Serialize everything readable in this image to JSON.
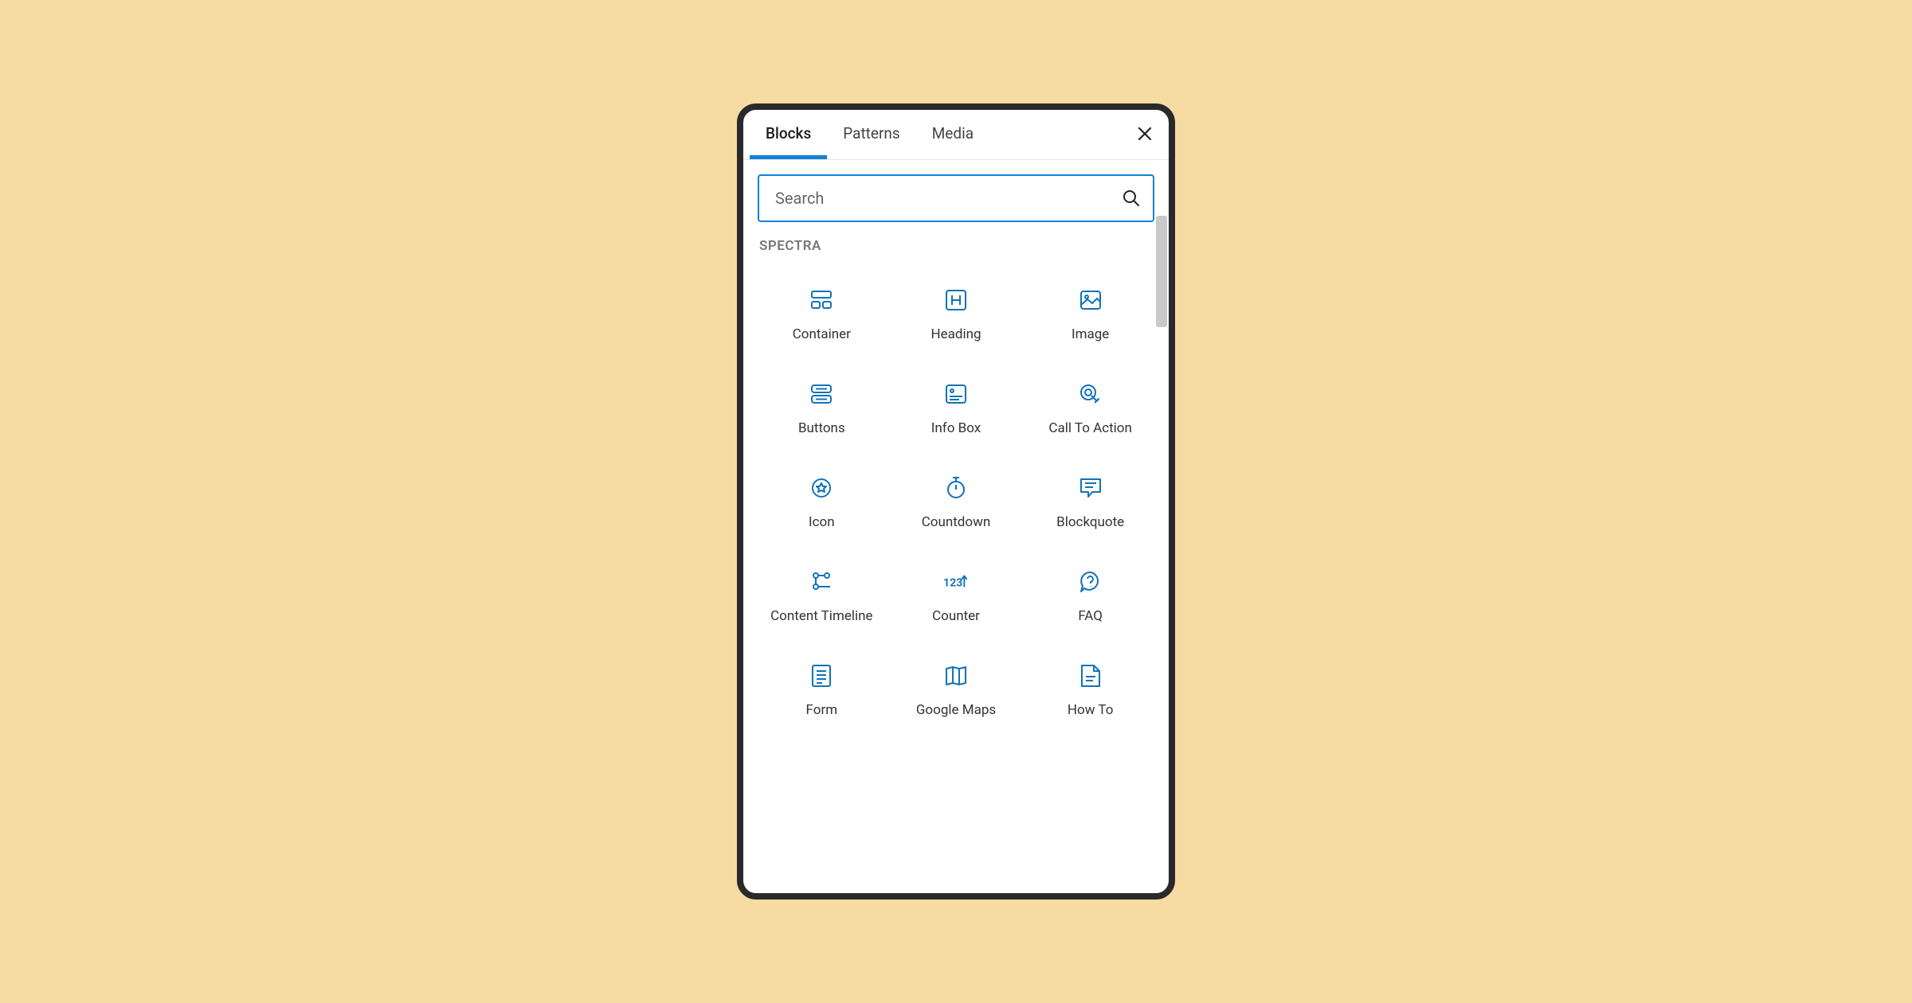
{
  "tabs": {
    "items": [
      "Blocks",
      "Patterns",
      "Media"
    ],
    "activeIndex": 0
  },
  "search": {
    "placeholder": "Search",
    "value": ""
  },
  "category": {
    "label": "SPECTRA"
  },
  "blocks": [
    {
      "label": "Container",
      "icon": "container"
    },
    {
      "label": "Heading",
      "icon": "heading"
    },
    {
      "label": "Image",
      "icon": "image"
    },
    {
      "label": "Buttons",
      "icon": "buttons"
    },
    {
      "label": "Info Box",
      "icon": "infobox"
    },
    {
      "label": "Call To Action",
      "icon": "cta"
    },
    {
      "label": "Icon",
      "icon": "icon"
    },
    {
      "label": "Countdown",
      "icon": "countdown"
    },
    {
      "label": "Blockquote",
      "icon": "blockquote"
    },
    {
      "label": "Content Timeline",
      "icon": "timeline"
    },
    {
      "label": "Counter",
      "icon": "counter"
    },
    {
      "label": "FAQ",
      "icon": "faq"
    },
    {
      "label": "Form",
      "icon": "form"
    },
    {
      "label": "Google Maps",
      "icon": "maps"
    },
    {
      "label": "How To",
      "icon": "howto"
    }
  ],
  "colors": {
    "accent": "#0f83d8",
    "iconStroke": "#1173b8"
  }
}
